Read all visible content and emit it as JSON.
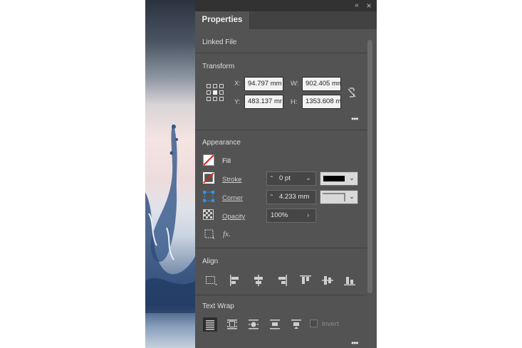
{
  "panel": {
    "tab_label": "Properties",
    "collapse_icon": "double-chevron-icon",
    "close_icon": "close-icon"
  },
  "linked_file": {
    "title": "Linked File"
  },
  "transform": {
    "title": "Transform",
    "x_label": "X:",
    "x_value": "94.797 mm",
    "y_label": "Y:",
    "y_value": "483.137 mr",
    "w_label": "W:",
    "w_value": "902.405 mm",
    "h_label": "H:",
    "h_value": "1353.608 m"
  },
  "appearance": {
    "title": "Appearance",
    "fill_label": "Fill",
    "stroke_label": "Stroke",
    "stroke_weight": "0 pt",
    "stroke_color": "#000000",
    "corner_label": "Corner",
    "corner_value": "4.233 mm",
    "opacity_label": "Opacity",
    "opacity_value": "100%"
  },
  "align": {
    "title": "Align"
  },
  "text_wrap": {
    "title": "Text Wrap",
    "invert_label": "Invert",
    "invert_checked": false
  },
  "colors": {
    "panel_bg": "#535353",
    "topbar_bg": "#323232",
    "accent_red": "#e0261b",
    "accent_blue": "#3d8ee6"
  }
}
